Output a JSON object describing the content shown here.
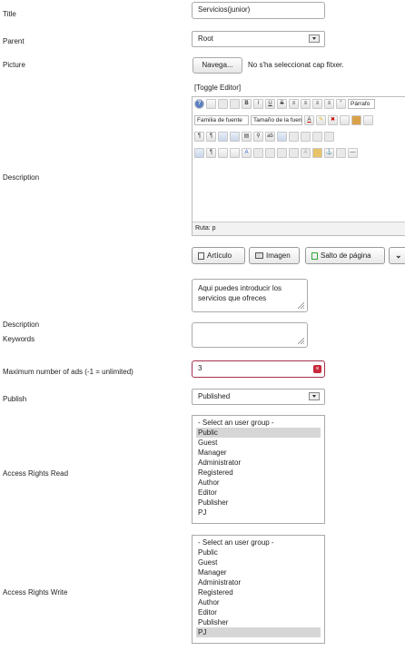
{
  "fields": {
    "title": {
      "label": "Title",
      "value": "Servicios(junior)"
    },
    "parent": {
      "label": "Parent",
      "value": "Root"
    },
    "picture": {
      "label": "Picture",
      "button": "Navega...",
      "status": "No s'ha seleccionat cap fitxer."
    },
    "description_editor": {
      "label": "Description",
      "toggle": "[Toggle Editor]",
      "path": "Ruta: p"
    },
    "description_short": {
      "label": "Description",
      "value": "Aqui puedes introducir los servicios que ofreces"
    },
    "keywords": {
      "label": "Keywords",
      "value": ""
    },
    "max_ads": {
      "label": "Maximum number of ads (-1 = unlimited)",
      "value": "3"
    },
    "publish": {
      "label": "Publish",
      "value": "Published"
    },
    "access_read": {
      "label": "Access Rights Read"
    },
    "access_write": {
      "label": "Access Rights Write"
    }
  },
  "editor": {
    "paragraph_dropdown": "Párrafo",
    "font_family_dropdown": "Familia de fuente",
    "font_size_dropdown": "Tamaño de la fuente",
    "row1_icons": [
      "help-icon",
      "new-document-icon",
      "undo-icon",
      "redo-icon",
      "bold-icon",
      "italic-icon",
      "underline-icon",
      "strikethrough-icon",
      "align-left-icon",
      "align-center-icon",
      "align-right-icon",
      "align-justify-icon",
      "blockquote-icon"
    ],
    "row1_glyphs": [
      "?",
      "",
      "",
      "",
      "B",
      "I",
      "U",
      "S",
      "",
      "",
      "",
      "",
      ""
    ]
  },
  "buttons": {
    "article": "Artículo",
    "image": "Imagen",
    "page_break": "Salto de página"
  },
  "user_groups": [
    "- Select an user group -",
    "Public",
    "Guest",
    "Manager",
    "Administrator",
    "Registered",
    "Author",
    "Editor",
    "Publisher",
    "PJ"
  ],
  "read_selected": "Public",
  "write_selected": "PJ",
  "colors": {
    "error_border": "#a4304d",
    "error_icon": "#c8283c"
  }
}
